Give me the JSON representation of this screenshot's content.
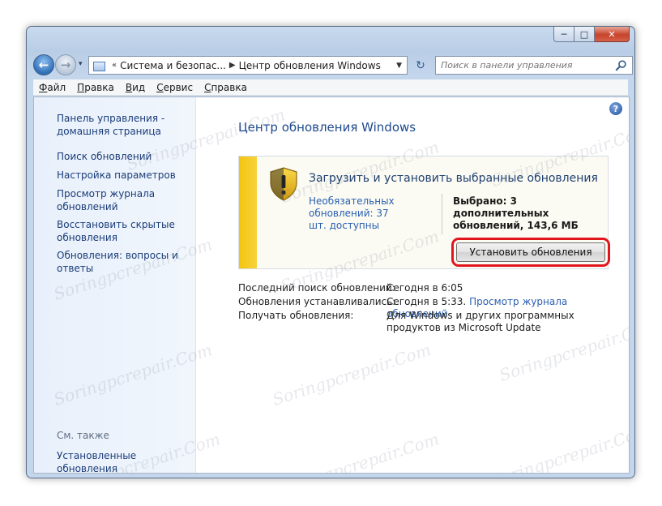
{
  "window": {
    "caption": {
      "min": "─",
      "max": "□",
      "close": "✕"
    }
  },
  "nav": {
    "back_glyph": "←",
    "fwd_glyph": "→",
    "recent_glyph": "▾",
    "breadcrumb": [
      "Система и безопас...",
      "Центр обновления Windows"
    ],
    "breadcrumb_sep": "▶",
    "breadcrumb_lead": "«",
    "dropdown_glyph": "▼",
    "refresh_glyph": "↻"
  },
  "search": {
    "placeholder": "Поиск в панели управления"
  },
  "menu": {
    "items": [
      {
        "u": "Ф",
        "rest": "айл"
      },
      {
        "u": "П",
        "rest": "равка"
      },
      {
        "u": "В",
        "rest": "ид"
      },
      {
        "u": "С",
        "rest": "ервис"
      },
      {
        "u": "С",
        "rest": "правка"
      }
    ]
  },
  "sidebar": {
    "home_link": "Панель управления - домашняя страница",
    "links": [
      "Поиск обновлений",
      "Настройка параметров",
      "Просмотр журнала обновлений",
      "Восстановить скрытые обновления",
      "Обновления: вопросы и ответы"
    ],
    "see_also": "См. также",
    "installed_updates": "Установленные обновления"
  },
  "main": {
    "title": "Центр обновления Windows",
    "help_glyph": "?",
    "panel": {
      "title": "Загрузить и установить выбранные обновления",
      "optional_link": "Необязательных обновлений: 37 шт. доступны",
      "selected": "Выбрано: 3 дополнительных обновлений, 143,6 МБ",
      "install_button": "Установить обновления"
    },
    "info": [
      {
        "label": "Последний поиск обновлений:",
        "value": "Сегодня в 6:05",
        "link": ""
      },
      {
        "label": "Обновления устанавливались:",
        "value": "Сегодня в 5:33.",
        "link": "Просмотр журнала обновлений"
      },
      {
        "label": "Получать обновления:",
        "value": "Для Windows и других программных продуктов из Microsoft Update",
        "link": ""
      }
    ]
  },
  "watermark": "Soringpcrepair.Com",
  "colors": {
    "accent_link": "#2a5fb0",
    "title": "#1e4a8c",
    "highlight": "#e3151c",
    "warning_strip": "#f3c40f"
  }
}
